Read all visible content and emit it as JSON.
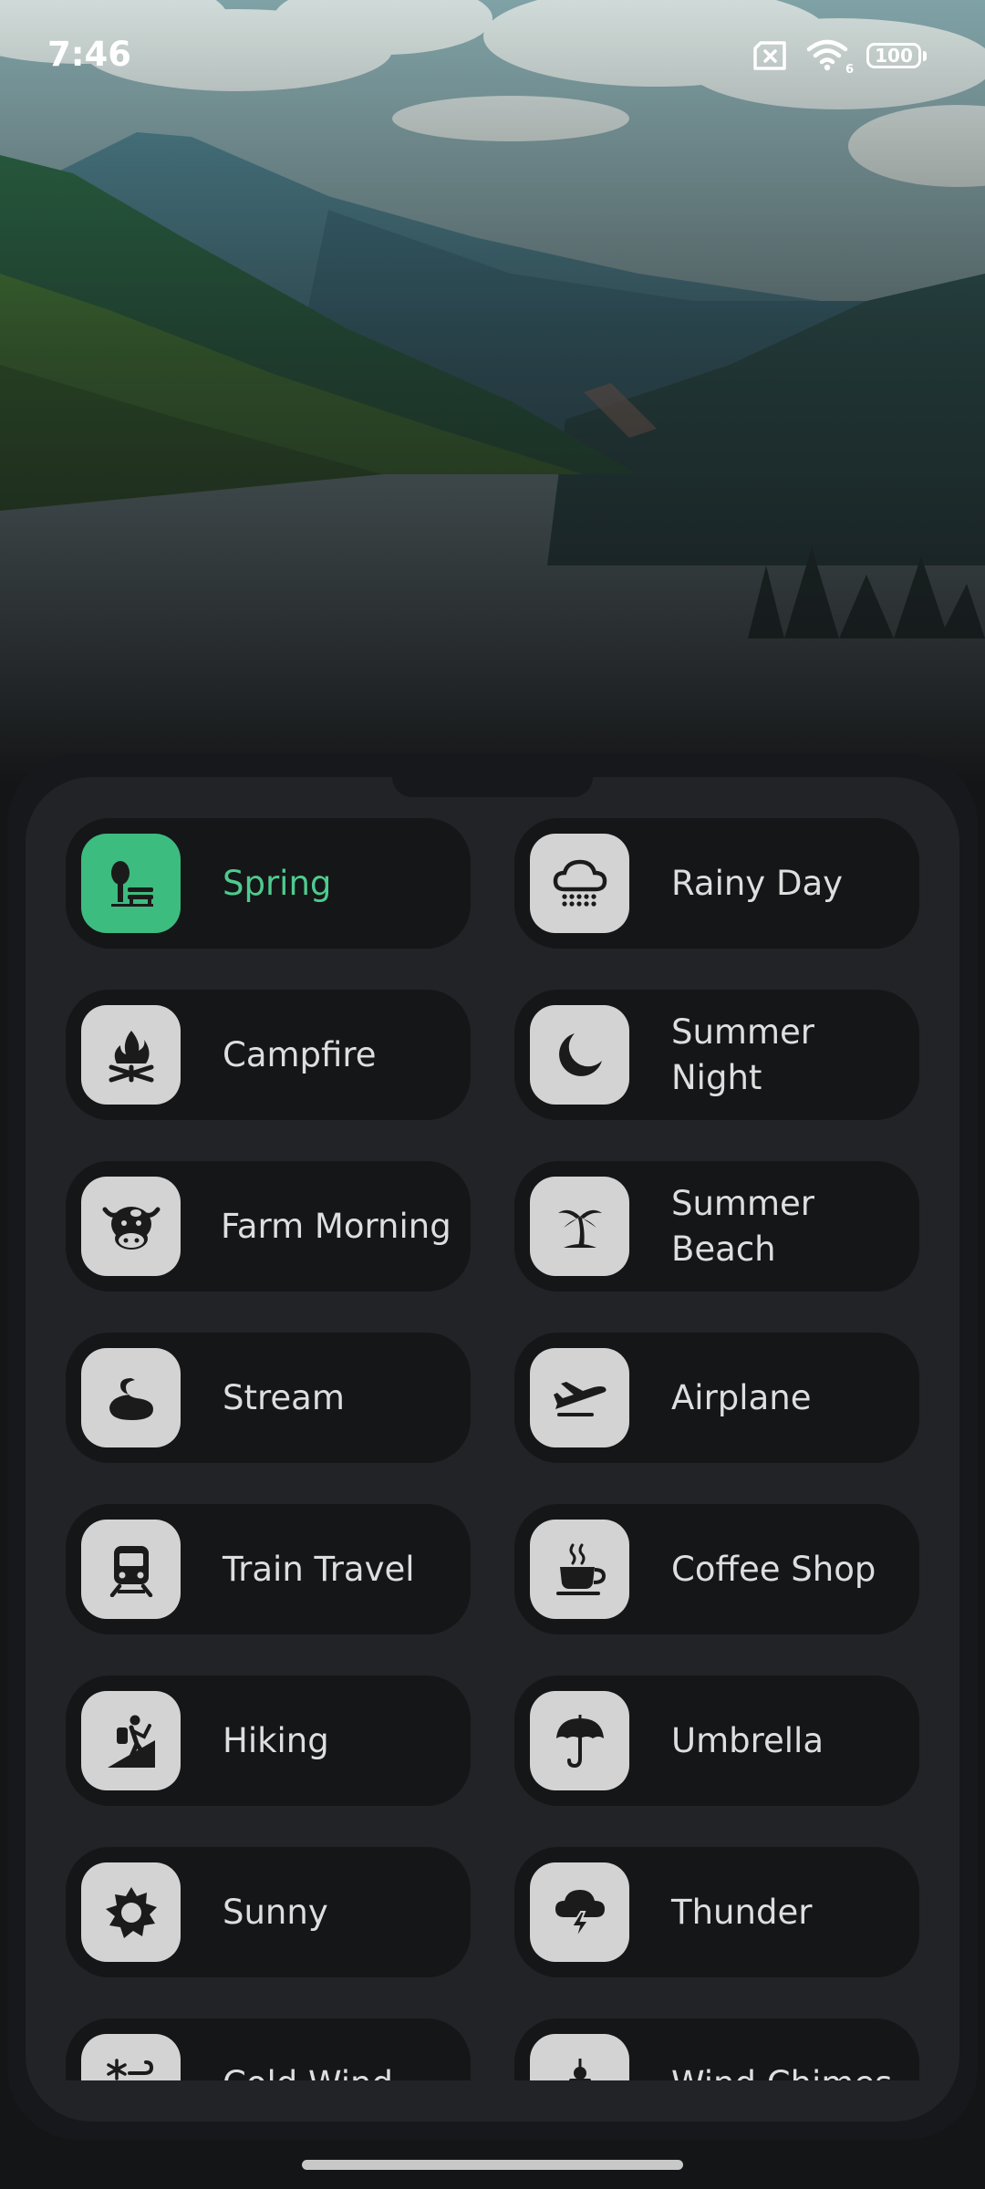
{
  "status_bar": {
    "time": "7:46",
    "wifi_level": "6",
    "battery": "100"
  },
  "colors": {
    "accent": "#3dbc7f",
    "tile_bg": "#151618",
    "panel_bg": "#222326",
    "icon_bg": "#d3d3d3"
  },
  "sounds": [
    {
      "label": "Spring",
      "icon": "bench-tree-icon",
      "active": true
    },
    {
      "label": "Rainy Day",
      "icon": "rain-cloud-icon",
      "active": false
    },
    {
      "label": "Campfire",
      "icon": "campfire-icon",
      "active": false
    },
    {
      "label": "Summer Night",
      "icon": "moon-icon",
      "active": false
    },
    {
      "label": "Farm Morning",
      "icon": "cow-icon",
      "active": false
    },
    {
      "label": "Summer Beach",
      "icon": "palm-tree-icon",
      "active": false
    },
    {
      "label": "Stream",
      "icon": "stream-icon",
      "active": false
    },
    {
      "label": "Airplane",
      "icon": "airplane-icon",
      "active": false
    },
    {
      "label": "Train Travel",
      "icon": "train-icon",
      "active": false
    },
    {
      "label": "Coffee Shop",
      "icon": "coffee-cup-icon",
      "active": false
    },
    {
      "label": "Hiking",
      "icon": "hiker-icon",
      "active": false
    },
    {
      "label": "Umbrella",
      "icon": "umbrella-icon",
      "active": false
    },
    {
      "label": "Sunny",
      "icon": "sun-icon",
      "active": false
    },
    {
      "label": "Thunder",
      "icon": "thunder-cloud-icon",
      "active": false
    },
    {
      "label": "Cold Wind",
      "icon": "cold-wind-icon",
      "active": false
    },
    {
      "label": "Wind Chimes",
      "icon": "wind-chimes-icon",
      "active": false
    }
  ]
}
